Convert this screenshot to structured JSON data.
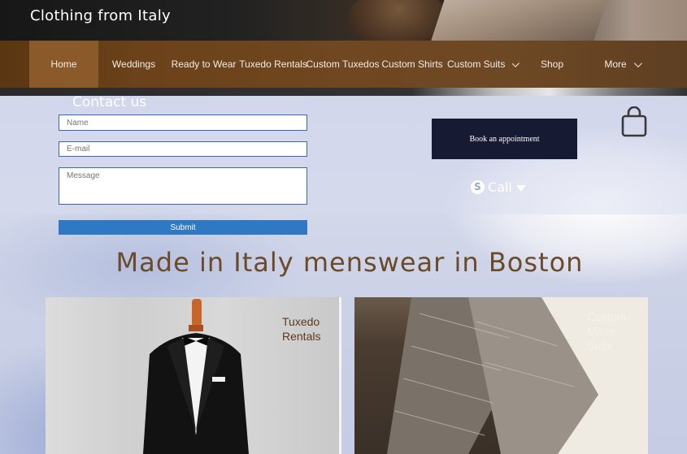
{
  "site": {
    "title": "Clothing from Italy"
  },
  "nav": {
    "items": [
      {
        "label": "Home",
        "active": true
      },
      {
        "label": "Weddings"
      },
      {
        "label": "Ready to Wear"
      },
      {
        "label": "Tuxedo Rentals"
      },
      {
        "label": "Custom Tuxedos"
      },
      {
        "label": "Custom Shirts"
      },
      {
        "label": "Custom Suits",
        "has_dropdown": true
      },
      {
        "label": "Shop"
      },
      {
        "label": "More",
        "has_dropdown": true
      }
    ]
  },
  "contact": {
    "heading": "Contact us",
    "name_placeholder": "Name",
    "email_placeholder": "E-mail",
    "message_placeholder": "Message",
    "submit_label": "Submit"
  },
  "actions": {
    "book_label": "Book an appointment",
    "call_label": "Call",
    "cart_icon": "shopping-bag-icon",
    "call_icon": "skype-icon"
  },
  "main": {
    "headline": "Made in Italy menswear in Boston",
    "cards": [
      {
        "label": "Tuxedo\nRentals"
      },
      {
        "label": "Custom\nMade\nSuits"
      }
    ]
  },
  "colors": {
    "accent_brown": "#6b4a2a",
    "nav_bg": "#6b4219",
    "nav_active": "#8a5a2a",
    "submit_blue": "#2f78c4",
    "book_navy": "#171a33"
  }
}
